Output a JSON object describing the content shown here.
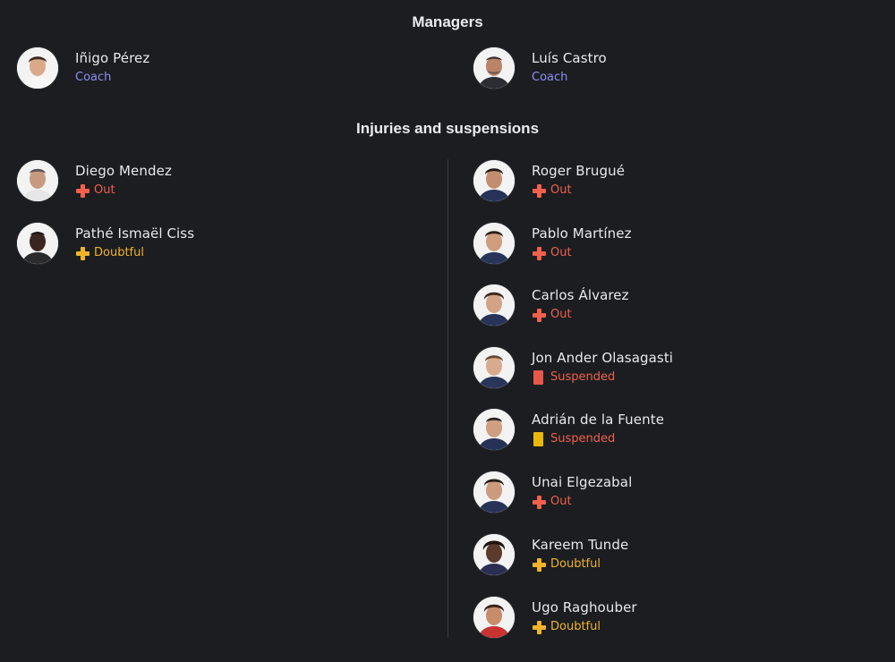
{
  "managers": {
    "title": "Managers",
    "home": {
      "name": "Iñigo Pérez",
      "role": "Coach"
    },
    "away": {
      "name": "Luís Castro",
      "role": "Coach"
    }
  },
  "injuries": {
    "title": "Injuries and suspensions",
    "home": [
      {
        "name": "Diego Mendez",
        "status": "Out",
        "icon": "plus-icon"
      },
      {
        "name": "Pathé Ismaël Ciss",
        "status": "Doubtful",
        "icon": "plus-icon"
      }
    ],
    "away": [
      {
        "name": "Roger Brugué",
        "status": "Out",
        "icon": "plus-icon"
      },
      {
        "name": "Pablo Martínez",
        "status": "Out",
        "icon": "plus-icon"
      },
      {
        "name": "Carlos Álvarez",
        "status": "Out",
        "icon": "plus-icon"
      },
      {
        "name": "Jon Ander Olasagasti",
        "status": "Suspended",
        "icon": "red-card-icon"
      },
      {
        "name": "Adrián de la Fuente",
        "status": "Suspended",
        "icon": "yellow-card-icon"
      },
      {
        "name": "Unai Elgezabal",
        "status": "Out",
        "icon": "plus-icon"
      },
      {
        "name": "Kareem Tunde",
        "status": "Doubtful",
        "icon": "plus-icon"
      },
      {
        "name": "Ugo Raghouber",
        "status": "Doubtful",
        "icon": "plus-icon"
      }
    ]
  },
  "colors": {
    "background": "#1b1d20",
    "coach": "#8d8ff2",
    "out": "#f0604d",
    "doubtful": "#f0b429",
    "red_card": "#e5584a",
    "yellow_card": "#e9b80a"
  }
}
